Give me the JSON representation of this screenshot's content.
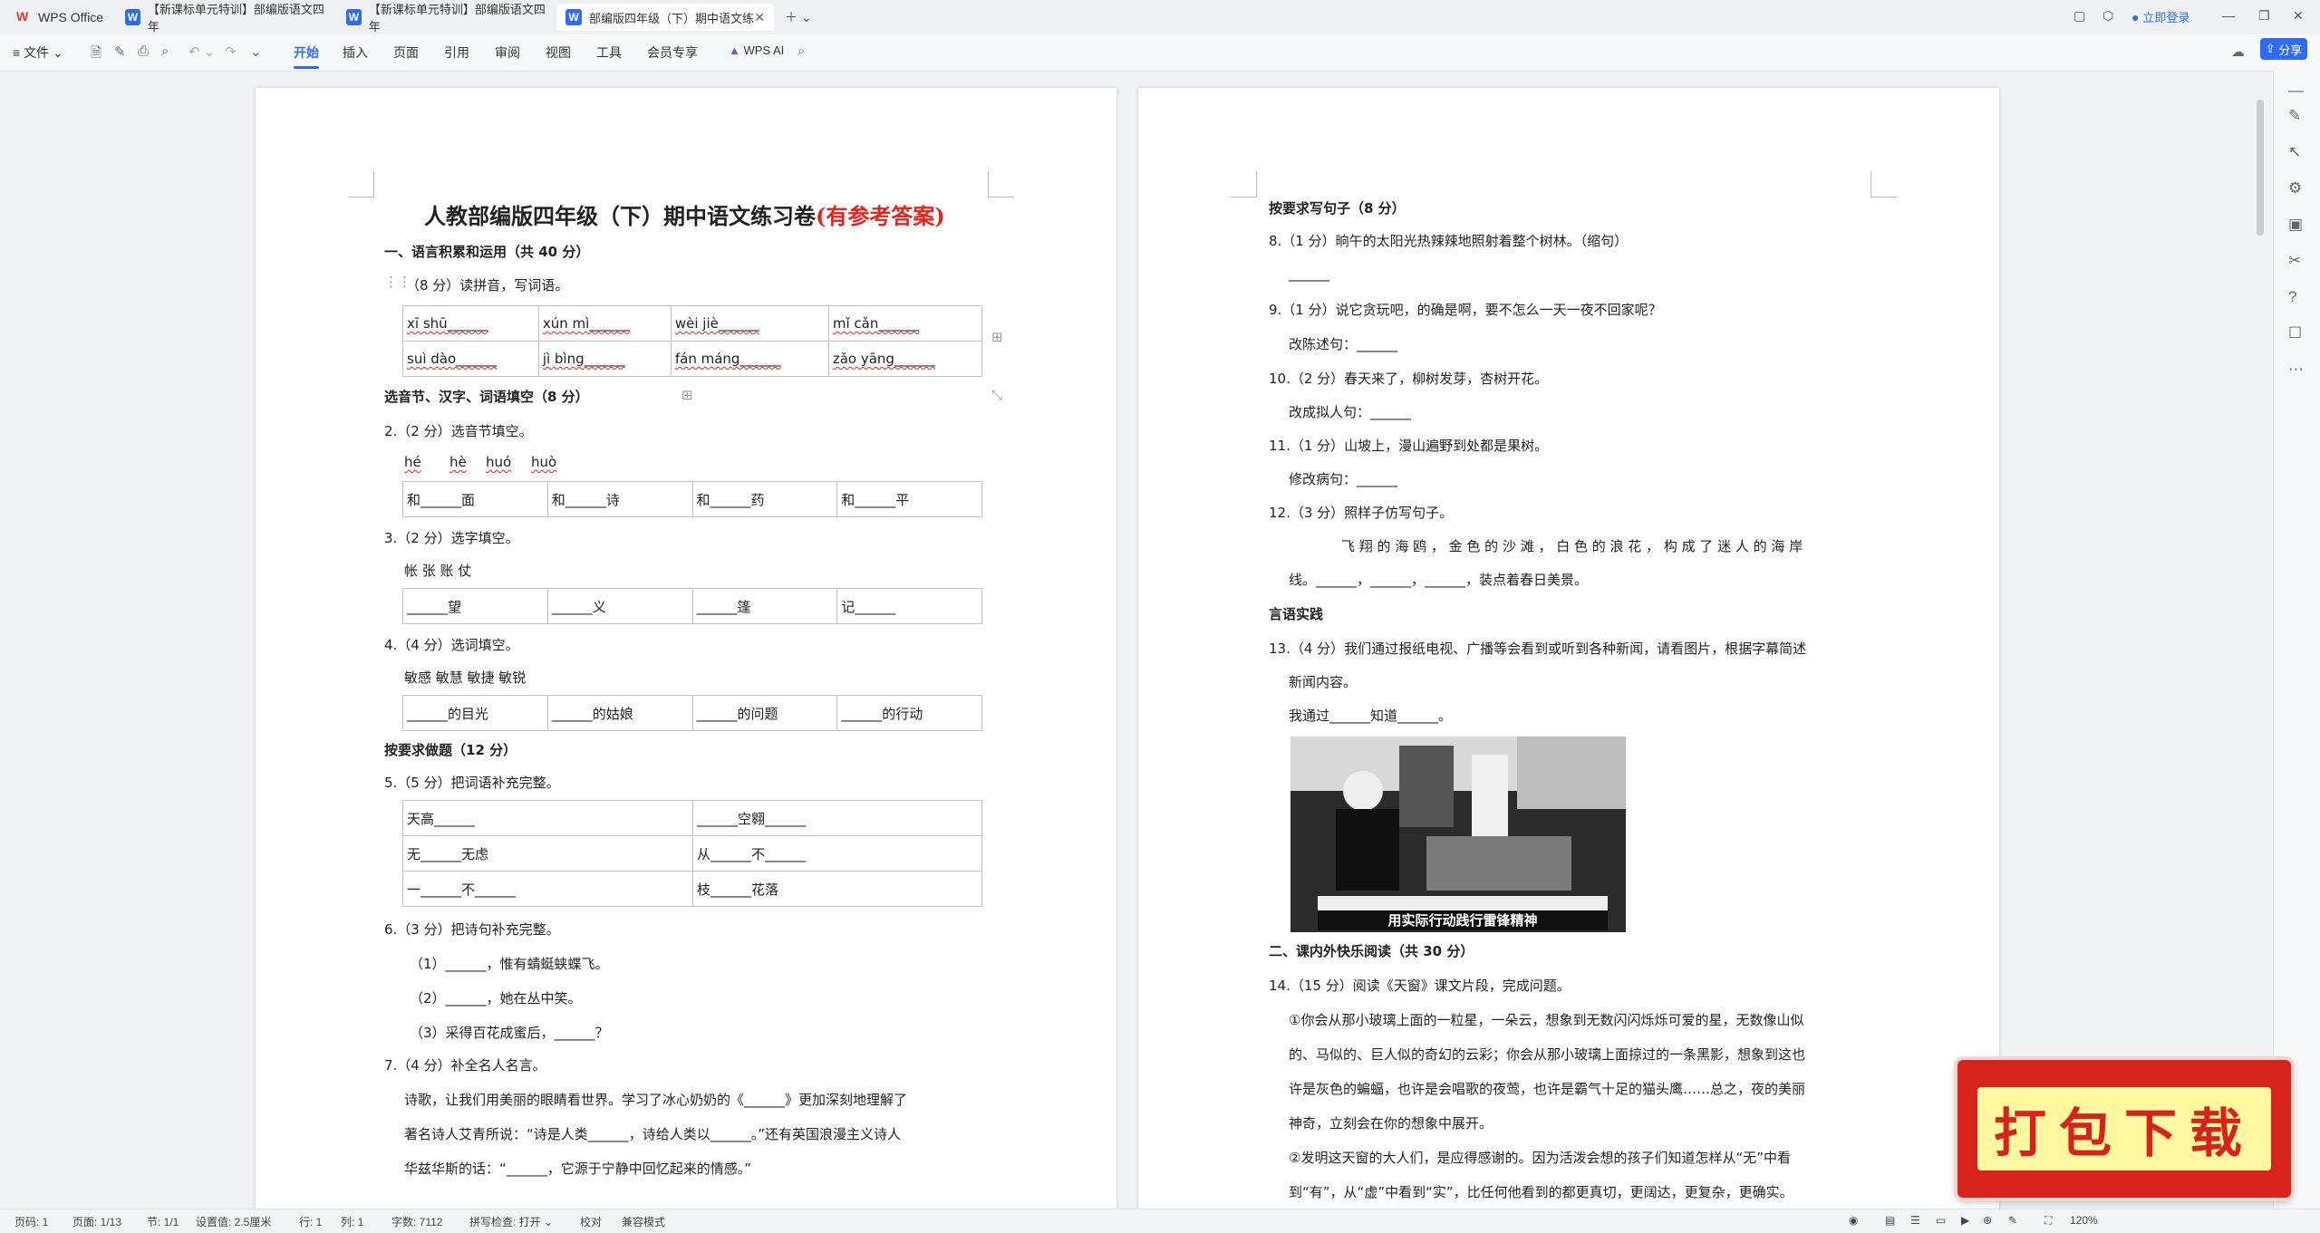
{
  "titlebar": {
    "tabs": [
      {
        "label": "WPS Office"
      },
      {
        "label": "【新课标单元特训】部编版语文四年"
      },
      {
        "label": "【新课标单元特训】部编版语文四年"
      },
      {
        "label": "部编版四年级（下）期中语文练"
      }
    ],
    "login": "立即登录"
  },
  "menubar": {
    "file": "文件",
    "items": [
      "开始",
      "插入",
      "页面",
      "引用",
      "审阅",
      "视图",
      "工具",
      "会员专享"
    ],
    "wps_ai": "WPS AI",
    "share": "分享"
  },
  "page1": {
    "title": "人教部编版四年级（下）期中语文练习卷",
    "title_suffix": "(有参考答案)",
    "s1": "一、语言积累和运用（共 40 分）",
    "q1": "（8 分）读拼音，写词语。",
    "pinyin_rows": [
      [
        "xī  shū______",
        "xún  mì______",
        "wèi  jiè______",
        "mǐ  cǎn______"
      ],
      [
        "suì  dào______",
        "jì  bìng______",
        "fán  máng______",
        "zǎo  yāng______"
      ]
    ],
    "s_sel": "选音节、汉字、词语填空（8 分）",
    "q2": "2.（2 分）选音节填空。",
    "q2_opts": [
      "hé",
      "hè",
      "huó",
      "huò"
    ],
    "q2_row": [
      "和______面",
      "和______诗",
      "和______药",
      "和______平"
    ],
    "q3": "3.（2 分）选字填空。",
    "q3_opts": "帐    张    账    仗",
    "q3_row": [
      "______望",
      "______义",
      "______篷",
      "记______"
    ],
    "q4": "4.（4 分）选词填空。",
    "q4_opts": "敏感    敏慧    敏捷    敏锐",
    "q4_row": [
      "______的目光",
      "______的姑娘",
      "______的问题",
      "______的行动"
    ],
    "s_req": "按要求做题（12 分）",
    "q5": "5.（5 分）把词语补充完整。",
    "q5_rows": [
      [
        "天高______",
        "______空翱______"
      ],
      [
        "无______无虑",
        "从______不______"
      ],
      [
        "一______不______",
        "枝______花落"
      ]
    ],
    "q6": "6.（3 分）把诗句补充完整。",
    "q6_lines": [
      "（1）______，惟有蜻蜓蛱蝶飞。",
      "（2）______，她在丛中笑。",
      "（3）采得百花成蜜后，______？"
    ],
    "q7": "7.（4 分）补全名人名言。",
    "q7_lines": [
      "诗歌，让我们用美丽的眼睛看世界。学习了冰心奶奶的《______》更加深刻地理解了",
      "著名诗人艾青所说：“诗是人类______，诗给人类以______。”还有英国浪漫主义诗人",
      "华兹华斯的话：“______，它源于宁静中回忆起来的情感。”"
    ]
  },
  "page2": {
    "s_sentence": "按要求写句子（8 分）",
    "q8": "8.（1 分）晌午的太阳光热辣辣地照射着整个树林。（缩句）",
    "q8_blank": "______",
    "q9": "9.（1 分）说它贪玩吧，的确是啊，要不怎么一天一夜不回家呢？",
    "q9_sub": "改陈述句：______",
    "q10": "10.（2 分）春天来了，柳树发芽，杏树开花。",
    "q10_sub": "改成拟人句：______",
    "q11": "11.（1 分）山坡上，漫山遍野到处都是果树。",
    "q11_sub": "修改病句：______",
    "q12": "12.（3 分）照样子仿写句子。",
    "q12_l1": "飞 翔 的 海 鸥 ， 金 色 的 沙 滩 ， 白 色 的 浪 花 ， 构 成 了 迷 人 的 海 岸",
    "q12_l2": "线。______，______，______，装点着春日美景。",
    "s_lang": "言语实践",
    "q13": "13.（4 分）我们通过报纸电视、广播等会看到或听到各种新闻，请看图片，根据字幕简述",
    "q13_l2": "新闻内容。",
    "q13_l3": "我通过______知道______。",
    "photo_caption": "用实际行动践行雷锋精神",
    "s2": "二、课内外快乐阅读（共 30 分）",
    "q14": "14.（15 分）阅读《天窗》课文片段，完成问题。",
    "q14_paras": [
      "①你会从那小玻璃上面的一粒星，一朵云，想象到无数闪闪烁烁可爱的星，无数像山似",
      "的、马似的、巨人似的奇幻的云彩；你会从那小玻璃上面掠过的一条黑影，想象到这也",
      "许是灰色的蝙蝠，也许是会唱歌的夜莺，也许是霸气十足的猫头鹰……总之，夜的美丽",
      "神奇，立刻会在你的想象中展开。",
      "②发明这天窗的大人们，是应得感谢的。因为活泼会想的孩子们知道怎样从“无”中看",
      "到“有”，从“虚”中看到“实”，比任何他看到的都更真切，更阔达，更复杂，更确实。"
    ]
  },
  "statusbar": {
    "page": "页码: 1",
    "pages": "页面: 1/13",
    "section": "节: 1/1",
    "setting": "设置值: 2.5厘米",
    "row": "行: 1",
    "col": "列: 1",
    "words": "字数: 7112",
    "spell": "拼写检查: 打开",
    "proof": "校对",
    "compat": "兼容模式",
    "zoom": "120%"
  },
  "banner": {
    "text": "打包下载"
  }
}
